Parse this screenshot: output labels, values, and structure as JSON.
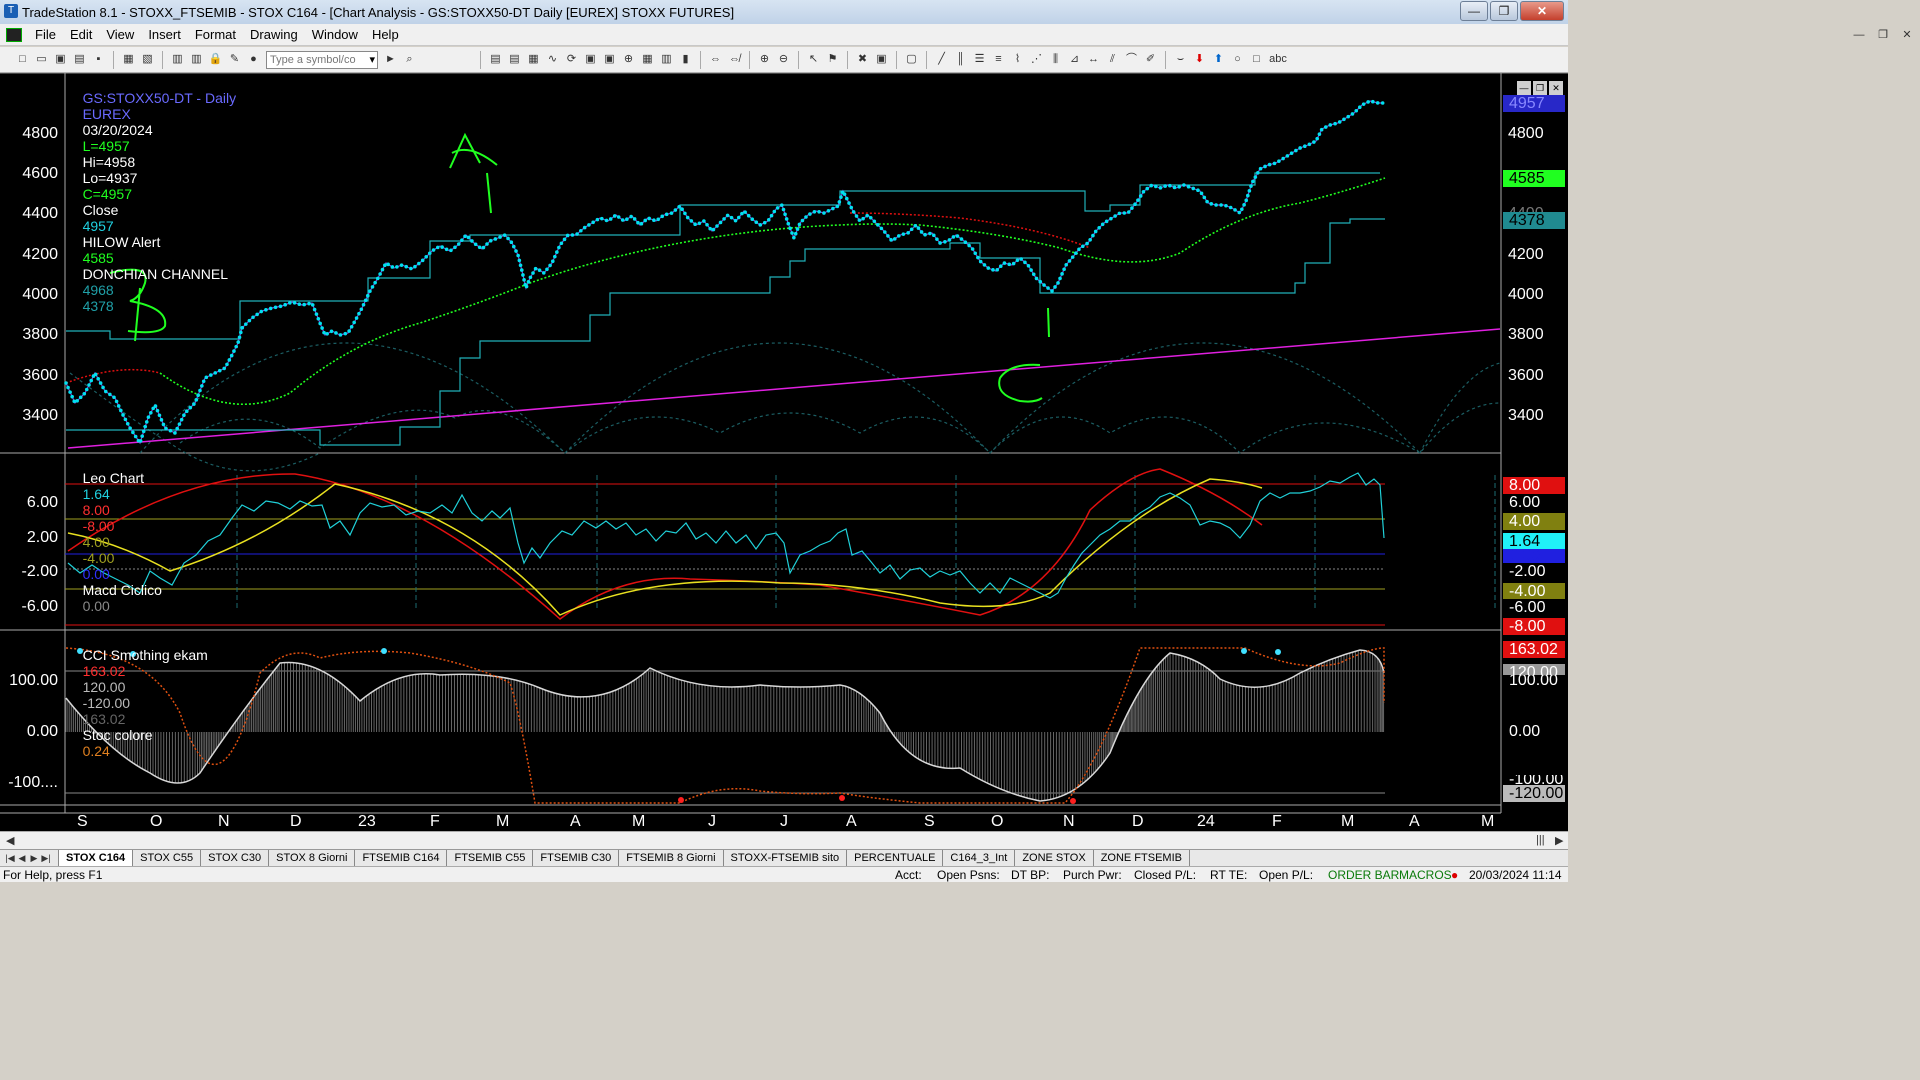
{
  "window": {
    "title": "TradeStation 8.1 - STOXX_FTSEMIB - STOX C164 - [Chart Analysis - GS:STOXX50-DT  Daily  [EUREX] STOXX FUTURES]"
  },
  "menu": [
    "File",
    "Edit",
    "View",
    "Insert",
    "Format",
    "Drawing",
    "Window",
    "Help"
  ],
  "toolbar": {
    "symbol_placeholder": "Type a symbol/co"
  },
  "price_pane": {
    "legend": {
      "symbol": "GS:STOXX50-DT - Daily",
      "exchange": "EUREX",
      "date": "03/20/2024",
      "last": "L=4957",
      "high": "Hi=4958",
      "low": "Lo=4937",
      "close": "C=4957",
      "close_label": "Close",
      "close_value": "4957",
      "hilow_label": "HILOW Alert",
      "hilow_value": "4585",
      "donchian_label": "DONCHIAN CHANNEL",
      "donchian_upper": "4968",
      "donchian_lower": "4378"
    },
    "y_ticks_left": [
      "4800",
      "4600",
      "4400",
      "4200",
      "4000",
      "3800",
      "3600",
      "3400"
    ],
    "y_ticks_right": [
      "4800",
      "4400",
      "4200",
      "4000",
      "3800",
      "3600",
      "3400"
    ],
    "tags": {
      "last": "4957",
      "hilow": "4585",
      "donchian_lower": "4378"
    },
    "annotations": [
      "A",
      "B",
      "C"
    ]
  },
  "macd_pane": {
    "title": "Leo Chart",
    "values": [
      "1.64",
      "8.00",
      "-8.00",
      "4.00",
      "-4.00",
      "0.00"
    ],
    "indicator": "Macd Ciclico",
    "indicator_value": "0.00",
    "y_ticks": [
      "6.00",
      "2.00",
      "-2.00",
      "-6.00"
    ],
    "tags": [
      "8.00",
      "6.00",
      "4.00",
      "1.64",
      "0.00",
      "-2.00",
      "-4.00",
      "-6.00",
      "-8.00"
    ]
  },
  "cci_pane": {
    "title": "CCI Smothing ekam",
    "values": [
      "163.02",
      "120.00",
      "-120.00",
      "163.02"
    ],
    "stoc_label": "Stoc colore",
    "stoc_value": "0.24",
    "y_ticks": [
      "100.00",
      "0.00",
      "-100...."
    ],
    "tags": [
      "163.02",
      "120.00",
      "100.00",
      "0.00",
      "-100.00",
      "-120.00"
    ]
  },
  "x_axis": [
    "S",
    "O",
    "N",
    "D",
    "23",
    "F",
    "M",
    "A",
    "M",
    "J",
    "J",
    "A",
    "S",
    "O",
    "N",
    "D",
    "24",
    "F",
    "M",
    "A",
    "M"
  ],
  "sheet_tabs": [
    "STOX C164",
    "STOX C55",
    "STOX  C30",
    "STOX  8 Giorni",
    "FTSEMIB C164",
    "FTSEMIB C55",
    "FTSEMIB C30",
    "FTSEMIB  8 Giorni",
    "STOXX-FTSEMIB sito",
    "PERCENTUALE",
    "C164_3_Int",
    "ZONE STOX",
    "ZONE FTSEMIB"
  ],
  "status": {
    "help": "For Help, press F1",
    "acct": "Acct:",
    "open_psns": "Open Psns:",
    "dt_bp": "DT BP:",
    "purch_pwr": "Purch Pwr:",
    "closed_pl": "Closed P/L:",
    "rt_te": "RT TE:",
    "open_pl": "Open P/L:",
    "order_bar": "ORDER BAR",
    "macros": "MACROS",
    "datetime": "20/03/2024 11:14"
  },
  "colors": {
    "price": "#00d8e8",
    "hilow": "#00ff00",
    "trend": "#e020e0",
    "donchian": "#20b0b8",
    "red_line": "#e01010",
    "yellow_line": "#e8e020",
    "annotation": "#00ff00"
  }
}
